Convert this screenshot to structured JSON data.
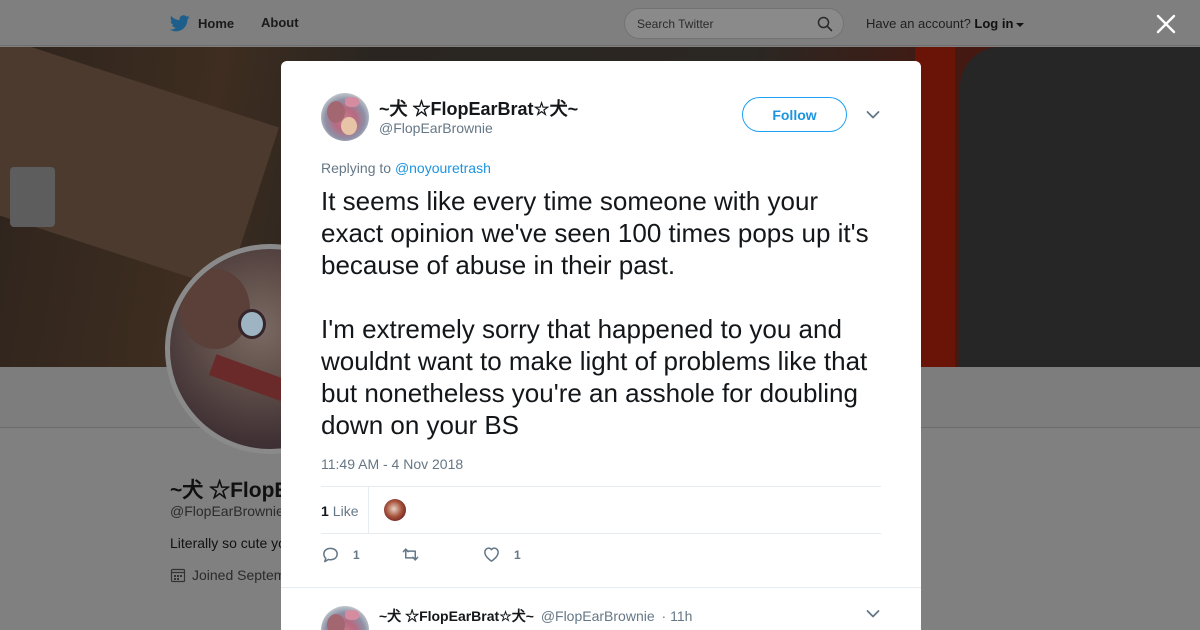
{
  "topbar": {
    "home_label": "Home",
    "about_label": "About",
    "search_placeholder": "Search Twitter",
    "have_account_text": "Have an account?",
    "login_label": "Log in"
  },
  "profile": {
    "name": "~犬 ☆FlopE",
    "handle": "@FlopEarBrownie",
    "bio": "Literally so cute yo",
    "joined": "Joined Septem"
  },
  "tweet": {
    "author_name": "~犬 ☆FlopEarBrat☆犬~",
    "author_handle": "@FlopEarBrownie",
    "follow_label": "Follow",
    "replying_prefix": "Replying to",
    "replying_to": "@noyouretrash",
    "paragraphs": [
      "It seems like every time someone with your exact opinion we've seen 100 times pops up it's because of abuse in their past.",
      "I'm extremely sorry that happened to you and wouldnt want to make light of problems like that but nonetheless you're an asshole for doubling down on your BS"
    ],
    "timestamp": "11:49 AM - 4 Nov 2018",
    "likes_count": "1",
    "likes_label": "Like",
    "reply_count": "1",
    "retweet_count": "",
    "like_count": "1"
  },
  "next_tweet": {
    "author_name": "~犬 ☆FlopEarBrat☆犬~",
    "author_handle": "@FlopEarBrownie",
    "time": "· 11h"
  },
  "colors": {
    "accent": "#1da1f2",
    "link": "#1b95e0",
    "muted_text": "#657786",
    "overlay": "#808080"
  },
  "icons": {
    "logo": "twitter-bird-icon",
    "search": "search-icon",
    "close": "close-icon",
    "reply": "reply-icon",
    "retweet": "retweet-icon",
    "like": "heart-icon",
    "calendar": "calendar-icon",
    "more": "chevron-down-icon"
  }
}
